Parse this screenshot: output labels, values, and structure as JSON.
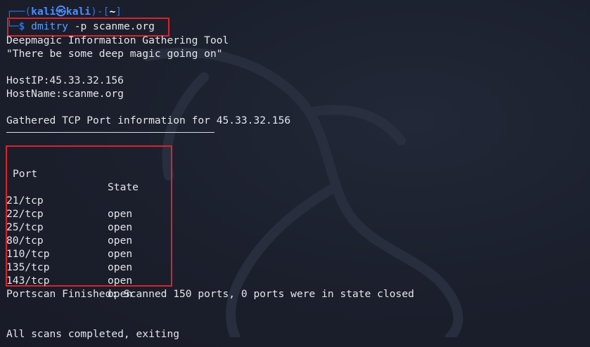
{
  "prompt": {
    "line1_prefix": "┌──(",
    "user": "kali",
    "at_symbol": "㉿",
    "host": "kali",
    "line1_mid": ")-[",
    "cwd": "~",
    "line1_suffix": "]",
    "line2_prefix": "└─",
    "dollar": "$",
    "command": "dmitry",
    "args": "-p scanme.org"
  },
  "output": {
    "banner_title": "Deepmagic Information Gathering Tool",
    "banner_quote": "\"There be some deep magic going on\"",
    "host_ip": "HostIP:45.33.32.156",
    "host_name": "HostName:scanme.org",
    "section_heading": "Gathered TCP Port information for 45.33.32.156",
    "ports_table": {
      "header_port": "Port",
      "header_state": "State",
      "rows": [
        {
          "port": "21/tcp",
          "state": "open"
        },
        {
          "port": "22/tcp",
          "state": "open"
        },
        {
          "port": "25/tcp",
          "state": "open"
        },
        {
          "port": "80/tcp",
          "state": "open"
        },
        {
          "port": "110/tcp",
          "state": "open"
        },
        {
          "port": "135/tcp",
          "state": "open"
        },
        {
          "port": "143/tcp",
          "state": "open"
        }
      ]
    },
    "portscan_summary": "Portscan Finished: Scanned 150 ports, 0 ports were in state closed",
    "completion": "All scans completed, exiting"
  },
  "colors": {
    "background": "#1b1f2c",
    "text": "#e4e6ea",
    "prompt_blue": "#4a8cff",
    "highlight_red": "#d8242b"
  },
  "icons": {
    "watermark": "kali-dragon-icon"
  }
}
